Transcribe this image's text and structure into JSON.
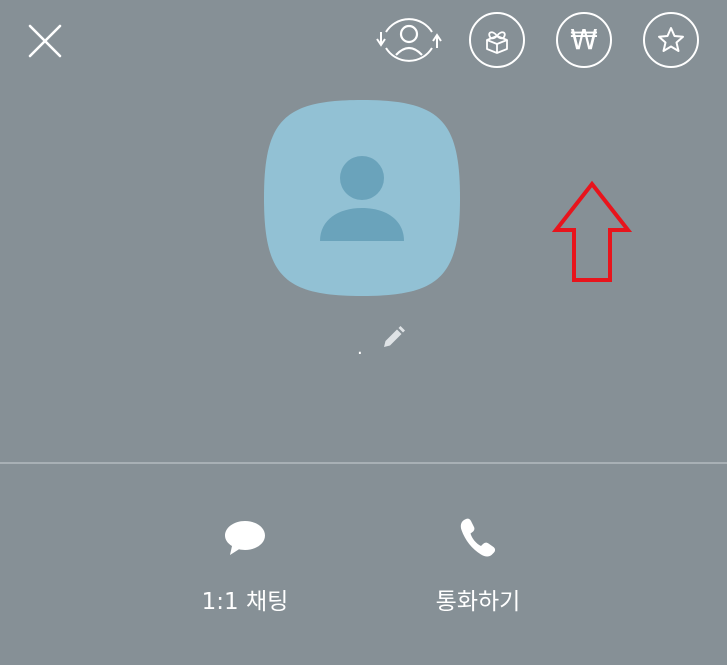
{
  "header": {
    "close_icon": "close-icon",
    "actions": [
      {
        "icon": "switch-profile-icon"
      },
      {
        "icon": "gift-icon"
      },
      {
        "icon": "won-pay-icon",
        "glyph": "₩"
      },
      {
        "icon": "star-icon"
      }
    ]
  },
  "profile": {
    "avatar_icon": "default-person-avatar",
    "name": ".",
    "edit_icon": "pencil-icon"
  },
  "bottom_actions": {
    "chat": {
      "icon": "speech-bubble-icon",
      "label": "1:1 채팅"
    },
    "call": {
      "icon": "phone-icon",
      "label": "통화하기"
    }
  },
  "colors": {
    "background": "#869096",
    "avatar_bg": "#92c1d4",
    "avatar_figure": "#6aa3bb",
    "annotation_arrow": "#e8141c"
  }
}
